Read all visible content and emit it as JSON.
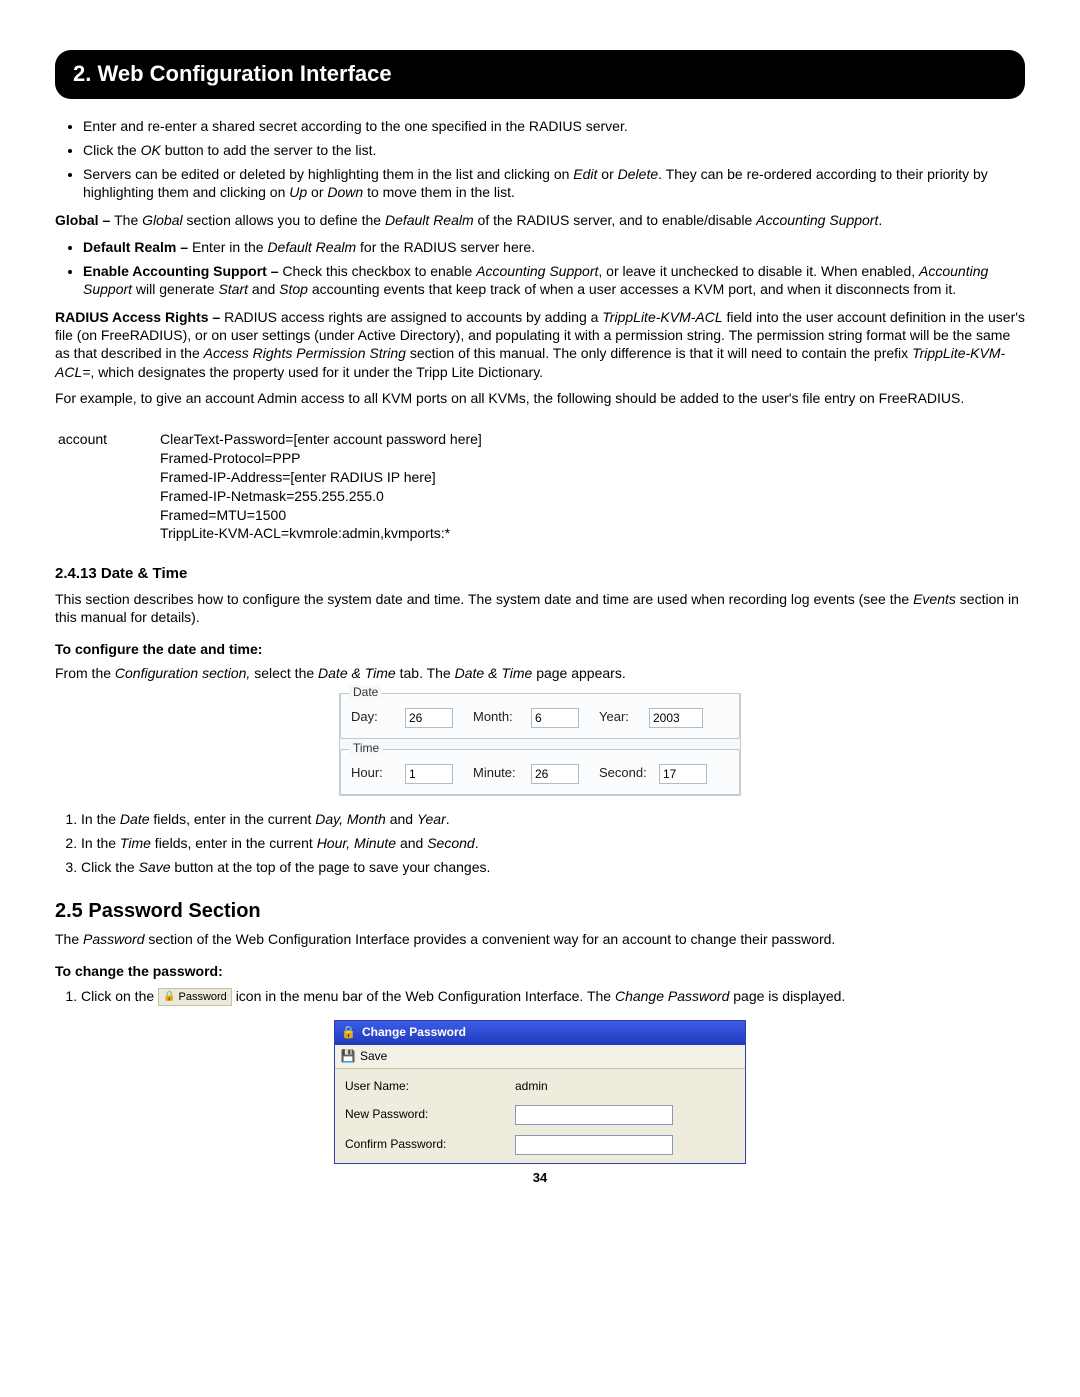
{
  "header": "2. Web Configuration Interface",
  "bullets": {
    "b1": "Enter and re-enter a shared secret according to the one specified in the RADIUS server.",
    "b2_a": "Click the ",
    "b2_ok": "OK",
    "b2_b": " button to add the server to the list.",
    "b3_a": "Servers can be edited or deleted by highlighting them in the list and clicking on ",
    "b3_edit": "Edit",
    "b3_or": " or ",
    "b3_delete": "Delete",
    "b3_b": ". They can be re-ordered according to their priority by highlighting them and clicking on ",
    "b3_up": "Up",
    "b3_or2": " or ",
    "b3_down": "Down",
    "b3_c": " to move them in the list."
  },
  "global": {
    "lead_b": "Global – ",
    "lead_a": "The ",
    "lead_g": "Global",
    "lead_c": " section allows you to define the ",
    "lead_dr": "Default Realm",
    "lead_d": " of the RADIUS server, and to enable/disable ",
    "lead_as": "Accounting Support",
    "lead_e": ".",
    "dr_b": "Default Realm – ",
    "dr_a": "Enter in the ",
    "dr_i": "Default Realm",
    "dr_c": " for the RADIUS server here.",
    "eas_b": "Enable Accounting Support – ",
    "eas_a": "Check this checkbox to enable ",
    "eas_i1": "Accounting Support",
    "eas_c": ", or leave it unchecked to disable it. When enabled, ",
    "eas_i2": "Accounting Support",
    "eas_d": " will generate ",
    "eas_i3": "Start",
    "eas_e": " and ",
    "eas_i4": "Stop",
    "eas_f": " accounting events that keep track of when a user accesses a KVM port, and when it disconnects from it."
  },
  "rar": {
    "b": "RADIUS Access Rights – ",
    "a": "RADIUS access rights are assigned to accounts by adding a ",
    "i1": "TrippLite-KVM-ACL",
    "c": " field into the user account definition in the user's file (on FreeRADIUS), or on user settings (under Active Directory), and populating it with a permission string. The permission string format will be the same as that described in the ",
    "i2": "Access Rights Permission String",
    "d": " section of this manual. The only difference is that it will need to contain the prefix ",
    "i3": "TrippLite-KVM-ACL=",
    "e": ", which designates the property used for it under the Tripp Lite Dictionary."
  },
  "example": "For example, to give an account Admin access to all KVM ports on all KVMs, the following should be added to the user's file entry on FreeRADIUS.",
  "code": {
    "label": "account",
    "l1": "ClearText-Password=[enter account password here]",
    "l2": "Framed-Protocol=PPP",
    "l3": "Framed-IP-Address=[enter RADIUS IP here]",
    "l4": "Framed-IP-Netmask=255.255.255.0",
    "l5": "Framed=MTU=1500",
    "l6": "TrippLite-KVM-ACL=kvmrole:admin,kvmports:*"
  },
  "dt": {
    "heading": "2.4.13 Date & Time",
    "p_a": "This section describes how to configure the system date and time. The system date and time are used when recording log events (see the ",
    "p_i": "Events",
    "p_b": " section in this manual for details).",
    "conf": "To configure the date and time:",
    "from_a": "From the ",
    "from_i1": "Configuration section,",
    "from_b": " select the ",
    "from_i2": "Date & Time",
    "from_c": " tab. The ",
    "from_i3": "Date & Time",
    "from_d": " page appears.",
    "date_legend": "Date",
    "time_legend": "Time",
    "day_lbl": "Day:",
    "month_lbl": "Month:",
    "year_lbl": "Year:",
    "hour_lbl": "Hour:",
    "minute_lbl": "Minute:",
    "second_lbl": "Second:",
    "day": "26",
    "month": "6",
    "year": "2003",
    "hour": "1",
    "minute": "26",
    "second": "17",
    "s1_a": "In the ",
    "s1_i1": "Date",
    "s1_b": " fields, enter in the current ",
    "s1_i2": "Day, Month",
    "s1_c": " and ",
    "s1_i3": "Year",
    "s1_d": ".",
    "s2_a": "In the ",
    "s2_i1": "Time",
    "s2_b": " fields, enter in the current ",
    "s2_i2": "Hour, Minute",
    "s2_c": " and ",
    "s2_i3": "Second",
    "s2_d": ".",
    "s3_a": "Click the ",
    "s3_i": "Save",
    "s3_b": " button at the top of the page to save your changes."
  },
  "pw": {
    "heading": "2.5 Password Section",
    "p_a": "The ",
    "p_i": "Password",
    "p_b": " section of the Web Configuration Interface provides a convenient way for an account to change their password.",
    "conf": "To change the password:",
    "s1_a": "Click on the ",
    "icon_label": "Password",
    "s1_b": " icon in the menu bar of the Web Configuration Interface. The ",
    "s1_i": "Change Password",
    "s1_c": " page is displayed.",
    "title": "Change Password",
    "save": "Save",
    "user_lbl": "User Name:",
    "user_val": "admin",
    "new_lbl": "New Password:",
    "confirm_lbl": "Confirm Password:"
  },
  "page": "34"
}
